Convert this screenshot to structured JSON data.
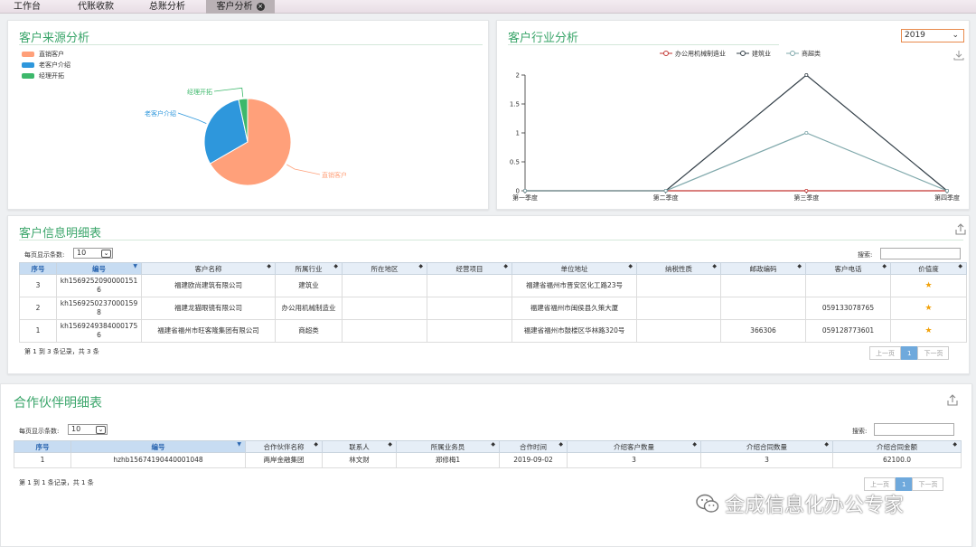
{
  "tabs": [
    {
      "label": "工作台"
    },
    {
      "label": "代账收款"
    },
    {
      "label": "总账分析"
    },
    {
      "label": "客户分析",
      "close": "×"
    }
  ],
  "colors": {
    "accent": "#3aa56a",
    "salmon": "#ffa07a",
    "blue": "#2e97dc",
    "green": "#3db86b",
    "line1": "#333f48",
    "line2": "#7fa8ab"
  },
  "source_panel": {
    "title": "客户来源分析",
    "chart_data": {
      "type": "pie",
      "slices": [
        {
          "name": "直销客户",
          "value": 2,
          "color": "#ffa07a"
        },
        {
          "name": "老客户介绍",
          "value": 0.9,
          "color": "#2e97dc"
        },
        {
          "name": "经理开拓",
          "value": 0.1,
          "color": "#3db86b"
        }
      ]
    }
  },
  "industry_panel": {
    "title": "客户行业分析",
    "year": "2019",
    "chart_data": {
      "type": "line",
      "categories": [
        "第一季度",
        "第二季度",
        "第三季度",
        "第四季度"
      ],
      "ylim": [
        0,
        2
      ],
      "yticks": [
        "0",
        "0.5",
        "1",
        "1.5",
        "2"
      ],
      "legend_position": "top-center",
      "series": [
        {
          "name": "办公用机械制造业",
          "values": [
            0,
            0,
            0,
            0
          ],
          "color": "#c23531"
        },
        {
          "name": "建筑业",
          "values": [
            0,
            0,
            2,
            0
          ],
          "color": "#333f48"
        },
        {
          "name": "商超类",
          "values": [
            0,
            0,
            1,
            0
          ],
          "color": "#7fa8ab"
        }
      ]
    }
  },
  "client_table": {
    "title": "客户信息明细表",
    "page_size_label": "每页显示条数:",
    "page_size": "10",
    "search_label": "搜索:",
    "columns": [
      "序号",
      "编号",
      "客户名称",
      "所属行业",
      "所在地区",
      "经营项目",
      "单位地址",
      "纳税性质",
      "邮政编码",
      "客户电话",
      "价值度"
    ],
    "rows": [
      {
        "no": "3",
        "code": "kh15692520900001516",
        "name": "福建欧尚建筑有限公司",
        "industry": "建筑业",
        "region": "",
        "business": "",
        "address": "福建省福州市晋安区化工路23号",
        "tax": "",
        "postcode": "",
        "phone": "",
        "value": "★"
      },
      {
        "no": "2",
        "code": "kh15692502370001598",
        "name": "福建龙猫眼镜有限公司",
        "industry": "办公用机械制造业",
        "region": "",
        "business": "",
        "address": "福建省福州市闽侯县久策大厦",
        "tax": "",
        "postcode": "",
        "phone": "059133078765",
        "value": "★"
      },
      {
        "no": "1",
        "code": "kh15692493840001756",
        "name": "福建省福州市旺客隆集团有限公司",
        "industry": "商超类",
        "region": "",
        "business": "",
        "address": "福建省福州市鼓楼区华林路320号",
        "tax": "",
        "postcode": "366306",
        "phone": "059128773601",
        "value": "★"
      }
    ],
    "summary": "第 1 到 3 条记录，共 3 条",
    "prev": "上一页",
    "page": "1",
    "next": "下一页"
  },
  "partner_table": {
    "title": "合作伙伴明细表",
    "page_size_label": "每页显示条数:",
    "page_size": "10",
    "search_label": "搜索:",
    "columns": [
      "序号",
      "编号",
      "合作伙伴名称",
      "联系人",
      "所属业务员",
      "合作时间",
      "介绍客户数量",
      "介绍合同数量",
      "介绍合同金额"
    ],
    "rows": [
      {
        "no": "1",
        "code": "hzhb15674190440001048",
        "name": "两岸金融集团",
        "contact": "林文财",
        "salesman": "郑修梅1",
        "date": "2019-09-02",
        "clients": "3",
        "contracts": "3",
        "amount": "62100.0"
      }
    ],
    "summary": "第 1 到 1 条记录，共 1 条",
    "prev": "上一页",
    "page": "1",
    "next": "下一页"
  },
  "watermark": {
    "text": "金成信息化办公专家",
    "icon": "wechat-icon"
  }
}
